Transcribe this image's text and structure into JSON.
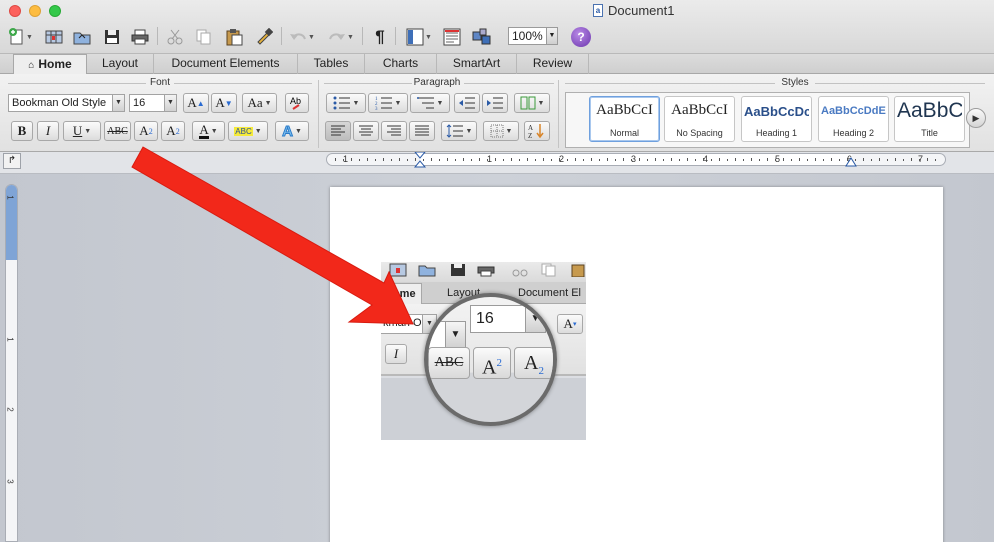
{
  "window": {
    "title": "Document1"
  },
  "toolbar": {
    "zoom_value": "100%",
    "help_label": "?",
    "icons": [
      "new-document-icon",
      "templates-icon",
      "open-icon",
      "save-icon",
      "print-icon",
      "cut-icon",
      "copy-icon",
      "paste-icon",
      "format-painter-icon",
      "undo-icon",
      "redo-icon",
      "pilcrow-icon",
      "sidebar-icon",
      "media-browser-icon",
      "toolbox-icon",
      "help-icon"
    ]
  },
  "ribbon": {
    "tabs": [
      "Home",
      "Layout",
      "Document Elements",
      "Tables",
      "Charts",
      "SmartArt",
      "Review"
    ],
    "active_tab": "Home",
    "groups": {
      "font": "Font",
      "paragraph": "Paragraph",
      "styles": "Styles"
    },
    "font": {
      "font_name": "Bookman Old Style",
      "font_size": "16",
      "grow_label": "A",
      "shrink_label": "A",
      "case_label": "Aa",
      "bold": "B",
      "italic": "I",
      "underline": "U",
      "strike": "ABC",
      "superscript_base": "A",
      "superscript_mark": "2",
      "subscript_base": "A",
      "subscript_mark": "2",
      "font_color_label": "A",
      "highlight_label": "ABC",
      "text_effects_label": "A"
    },
    "styles": [
      {
        "preview": "AaBbCcI",
        "name": "Normal",
        "selected": true
      },
      {
        "preview": "AaBbCcI",
        "name": "No Spacing",
        "selected": false
      },
      {
        "preview": "AaBbCcDc",
        "name": "Heading 1",
        "selected": false
      },
      {
        "preview": "AaBbCcDdEe",
        "name": "Heading 2",
        "selected": false
      },
      {
        "preview": "AaBbC",
        "name": "Title",
        "selected": false
      }
    ]
  },
  "ruler": {
    "horizontal_numbers": [
      "1",
      "1",
      "2",
      "3",
      "4",
      "5",
      "6",
      "7"
    ],
    "vertical_numbers": [
      "1",
      "1",
      "2",
      "3"
    ]
  },
  "inset": {
    "tabs": [
      "Home",
      "Layout",
      "Document El"
    ],
    "font_name_partial": "kman Old",
    "font_size": "16",
    "italic": "I",
    "strike": "ABC",
    "superscript_base": "A",
    "superscript_mark": "2",
    "subscript_base": "A",
    "subscript_mark": "2",
    "grow_label": "A"
  },
  "colors": {
    "annotation_arrow": "#f2281a",
    "accent": "#2a6bd2"
  }
}
